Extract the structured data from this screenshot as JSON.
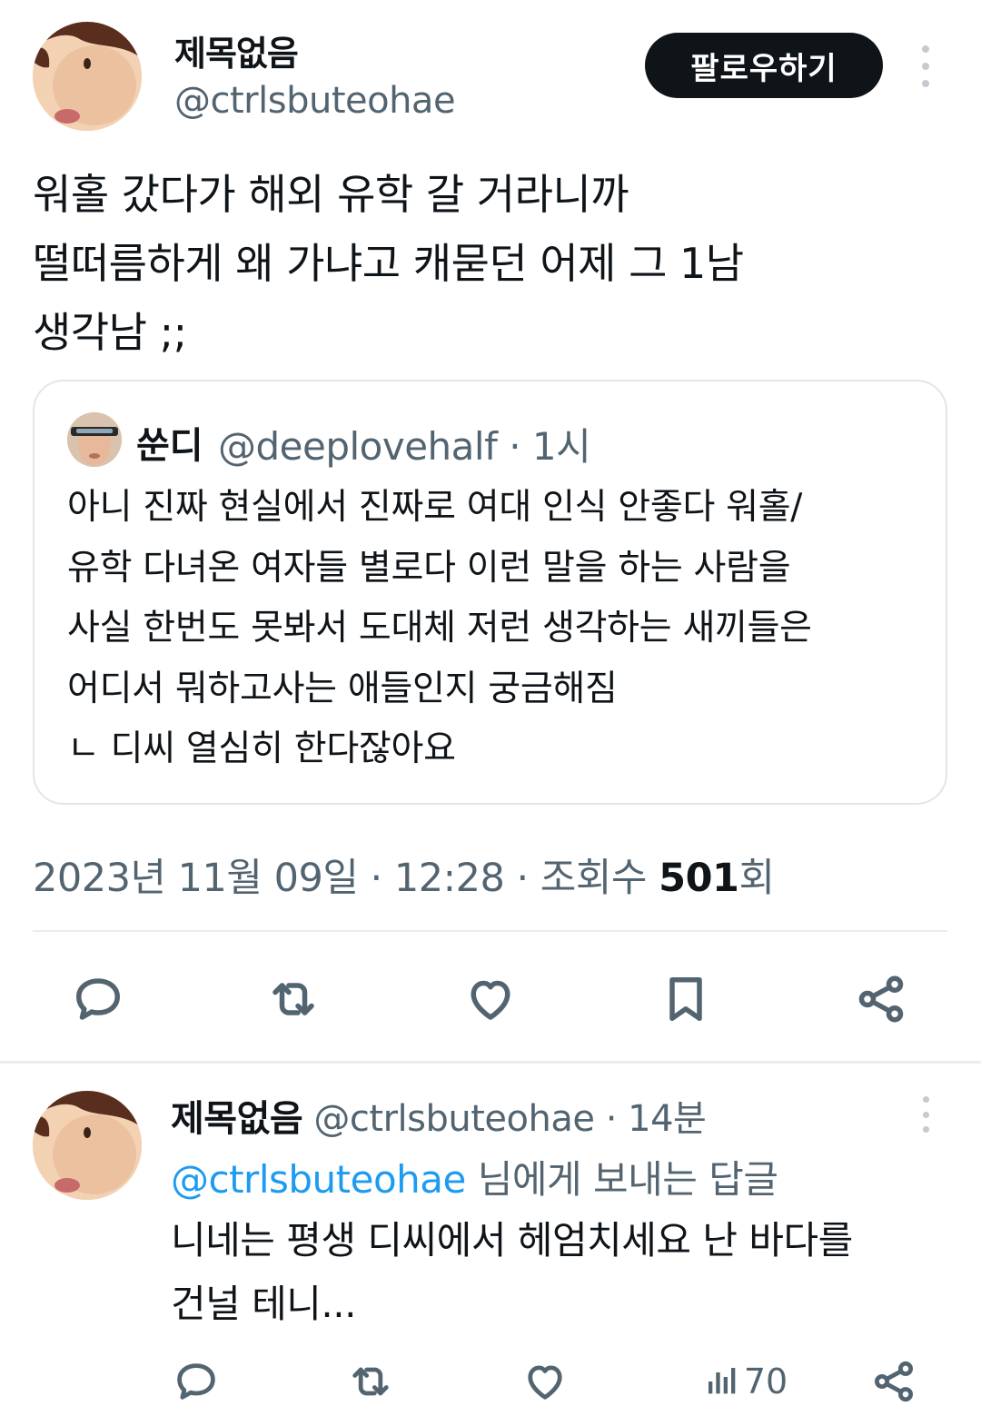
{
  "tweet": {
    "author_name": "제목없음",
    "author_handle": "@ctrlsbuteohae",
    "follow_label": "팔로우하기",
    "text_lines": [
      "워홀 갔다가 해외 유학 갈 거라니까",
      "떨떠름하게 왜 가냐고 캐묻던 어제 그 1남",
      "생각남 ;;"
    ],
    "quote": {
      "name": "쑨디",
      "handle_time": "@deeplovehalf · 1시",
      "text_lines": [
        "아니 진짜 현실에서 진짜로 여대 인식 안좋다 워홀/",
        "유학 다녀온 여자들 별로다 이런 말을 하는 사람을",
        "사실 한번도 못봐서 도대체 저런 생각하는 새끼들은",
        "어디서 뭐하고사는 애들인지 궁금해짐",
        "ㄴ 디씨 열심히 한다잖아요"
      ]
    },
    "meta_prefix": "2023년 11월 09일 · 12:28 · 조회수 ",
    "views": "501",
    "views_suffix": "회",
    "icons": {
      "reply": "reply-icon",
      "retweet": "retweet-icon",
      "like": "heart-icon",
      "bookmark": "bookmark-icon",
      "share": "share-icon"
    }
  },
  "reply": {
    "author_name": "제목없음",
    "handle_time": " @ctrlsbuteohae · 14분",
    "reply_to_mention": "@ctrlsbuteohae",
    "reply_to_suffix": " 님에게 보내는 답글",
    "text_lines": [
      "니네는 평생 디씨에서 헤엄치세요 난 바다를",
      "건널 테니..."
    ],
    "views": "70"
  },
  "colors": {
    "text": "#0f1419",
    "secondary": "#536471",
    "link": "#1d9bf0",
    "border": "#e1e6ea"
  }
}
